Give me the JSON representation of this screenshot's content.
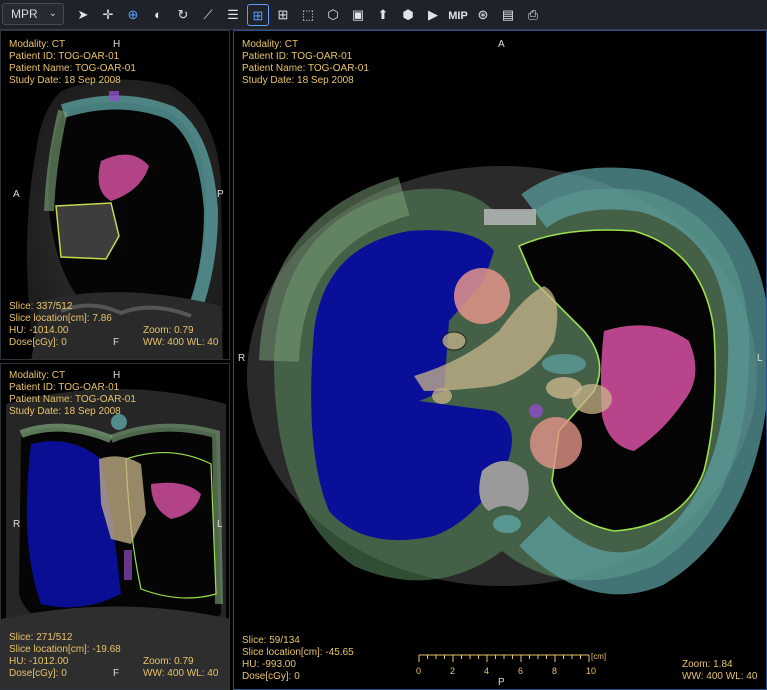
{
  "toolbar": {
    "mode_label": "MPR",
    "tools": [
      {
        "name": "pointer-tool",
        "icon": "arrow-pointer-icon",
        "glyph": "➤"
      },
      {
        "name": "pan-tool",
        "icon": "move-cross-icon",
        "glyph": "✛"
      },
      {
        "name": "zoom-tool",
        "icon": "magnifier-plus-icon",
        "glyph": "⊕"
      },
      {
        "name": "window-level-tool",
        "icon": "contrast-circle-icon",
        "glyph": "◐"
      },
      {
        "name": "rotate-tool",
        "icon": "rotate-arrows-icon",
        "glyph": "↻"
      },
      {
        "name": "measure-tool",
        "icon": "ruler-line-icon",
        "glyph": "⟋"
      },
      {
        "name": "stack-tool",
        "icon": "stacked-layers-icon",
        "glyph": "☰"
      },
      {
        "name": "crosshair-tool",
        "icon": "crosshair-box-icon",
        "glyph": "⊞"
      },
      {
        "name": "layout-tool",
        "icon": "grid-layout-icon",
        "glyph": "⊞"
      },
      {
        "name": "roi-tool",
        "icon": "dashed-select-icon",
        "glyph": "⬚"
      },
      {
        "name": "3d-tool",
        "icon": "cube-icon",
        "glyph": "⬡"
      },
      {
        "name": "mask-tool",
        "icon": "square-fill-icon",
        "glyph": "▣"
      },
      {
        "name": "export-tool",
        "icon": "upload-box-icon",
        "glyph": "⬆"
      },
      {
        "name": "volume-tool",
        "icon": "cube-rotate-icon",
        "glyph": "⬢"
      },
      {
        "name": "play-button",
        "icon": "play-icon",
        "glyph": "▶"
      },
      {
        "name": "mip-button",
        "icon": "mip-text-icon",
        "glyph": "MIP"
      },
      {
        "name": "fusion-tool",
        "icon": "overlap-circles-icon",
        "glyph": "⊛"
      },
      {
        "name": "report-tool",
        "icon": "document-lines-icon",
        "glyph": "▤"
      },
      {
        "name": "pdf-tool",
        "icon": "pdf-file-icon",
        "glyph": "⎙"
      }
    ],
    "active_tool_index": 2,
    "boxed_tool_index": 7
  },
  "sagittal": {
    "modality": "Modality: CT",
    "patient_id": "Patient ID: TOG-OAR-01",
    "patient_name": "Patient Name: TOG-OAR-01",
    "study_date": "Study Date: 18 Sep 2008",
    "slice": "Slice: 337/512",
    "slice_location": "Slice location[cm]: 7.86",
    "hu": "HU: -1014.00",
    "zoom": "Zoom: 0.79",
    "dose": "Dose[cGy]: 0",
    "wwwl": "WW: 400 WL: 40",
    "orient_top": "H",
    "orient_left": "A",
    "orient_right": "P",
    "orient_bottom": "F"
  },
  "coronal": {
    "modality": "Modality: CT",
    "patient_id": "Patient ID: TOG-OAR-01",
    "patient_name": "Patient Name: TOG-OAR-01",
    "study_date": "Study Date: 18 Sep 2008",
    "slice": "Slice: 271/512",
    "slice_location": "Slice location[cm]: -19.68",
    "hu": "HU: -1012.00",
    "zoom": "Zoom: 0.79",
    "dose": "Dose[cGy]: 0",
    "wwwl": "WW: 400 WL: 40",
    "orient_top": "H",
    "orient_left": "R",
    "orient_right": "L",
    "orient_bottom": "F"
  },
  "axial": {
    "modality": "Modality: CT",
    "patient_id": "Patient ID: TOG-OAR-01",
    "patient_name": "Patient Name: TOG-OAR-01",
    "study_date": "Study Date: 18 Sep 2008",
    "slice": "Slice: 59/134",
    "slice_location": "Slice location[cm]: -45.65",
    "hu": "HU: -993.00",
    "zoom": "Zoom: 1.84",
    "dose": "Dose[cGy]: 0",
    "wwwl": "WW: 400 WL: 40",
    "orient_top": "A",
    "orient_left": "R",
    "orient_right": "L",
    "orient_bottom": "P",
    "ruler_labels": [
      "0",
      "2",
      "4",
      "6",
      "8",
      "10"
    ],
    "ruler_unit": "[cm]"
  },
  "colors": {
    "lung_right": "#0a0f9a",
    "heart_magenta": "#d14f9e",
    "esophagus_tan": "#c8b48a",
    "aorta_salmon": "#e29489",
    "ribcage_green": "#7fa67b",
    "ribcage_teal": "#5fa5a6",
    "lung_left_contour": "#9be14a",
    "overlay_text": "#e8c36a"
  }
}
